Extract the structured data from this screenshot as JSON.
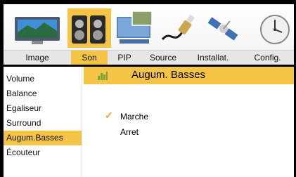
{
  "tabs": [
    {
      "label": "Image"
    },
    {
      "label": "Son"
    },
    {
      "label": "PIP"
    },
    {
      "label": "Source"
    },
    {
      "label": "Installat."
    },
    {
      "label": "Config."
    }
  ],
  "sidebar": {
    "items": [
      {
        "label": "Volume"
      },
      {
        "label": "Balance"
      },
      {
        "label": "Egaliseur"
      },
      {
        "label": "Surround"
      },
      {
        "label": "Augum.Basses"
      },
      {
        "label": "Écouteur"
      }
    ]
  },
  "panel": {
    "title": "Augum. Basses",
    "options": [
      {
        "label": "Marche",
        "checked": true
      },
      {
        "label": "Arret",
        "checked": false
      }
    ]
  },
  "colors": {
    "accent": "#f4c447"
  }
}
